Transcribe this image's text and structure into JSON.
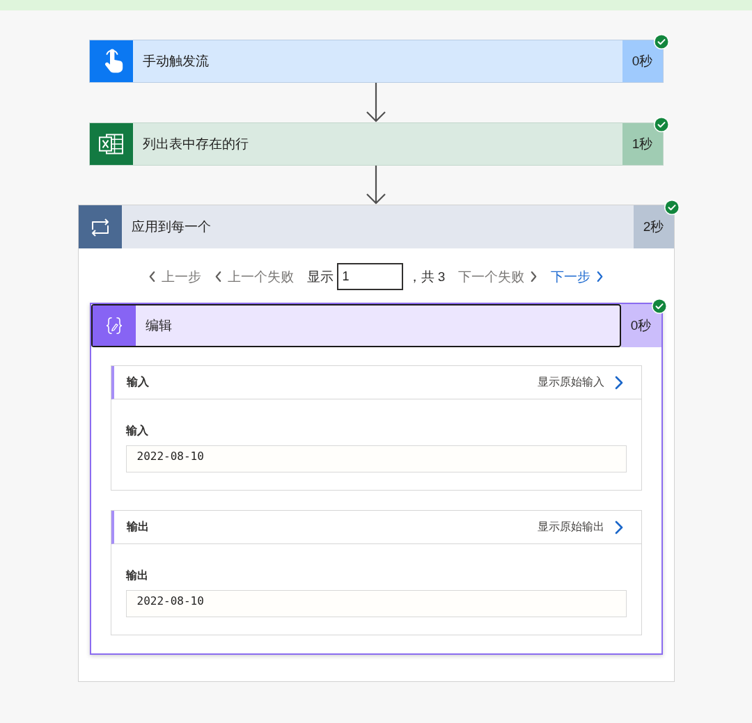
{
  "steps": [
    {
      "kind": "trigger",
      "title": "手动触发流",
      "duration": "0秒",
      "succeeded": true,
      "selected": false
    },
    {
      "kind": "excel",
      "title": "列出表中存在的行",
      "duration": "1秒",
      "succeeded": true,
      "selected": false
    }
  ],
  "loop": {
    "kind": "loop",
    "title": "应用到每一个",
    "duration": "2秒",
    "succeeded": true,
    "selected": false,
    "pager": {
      "back": [
        {
          "label": "上一步",
          "disabled": true
        },
        {
          "label": "上一个失败",
          "disabled": true
        }
      ],
      "label": "显示",
      "value": "1",
      "total": "，共 3",
      "forward": [
        {
          "label": "下一个失败",
          "disabled": true
        },
        {
          "label": "下一步",
          "disabled": false
        }
      ]
    },
    "action": {
      "kind": "compose",
      "title": "编辑",
      "duration": "0秒",
      "succeeded": true,
      "selected": true,
      "sections": [
        {
          "title": "输入",
          "link": "显示原始输入",
          "field_label": "输入",
          "value": "2022-08-10"
        },
        {
          "title": "输出",
          "link": "显示原始输出",
          "field_label": "输出",
          "value": "2022-08-10"
        }
      ]
    }
  }
}
